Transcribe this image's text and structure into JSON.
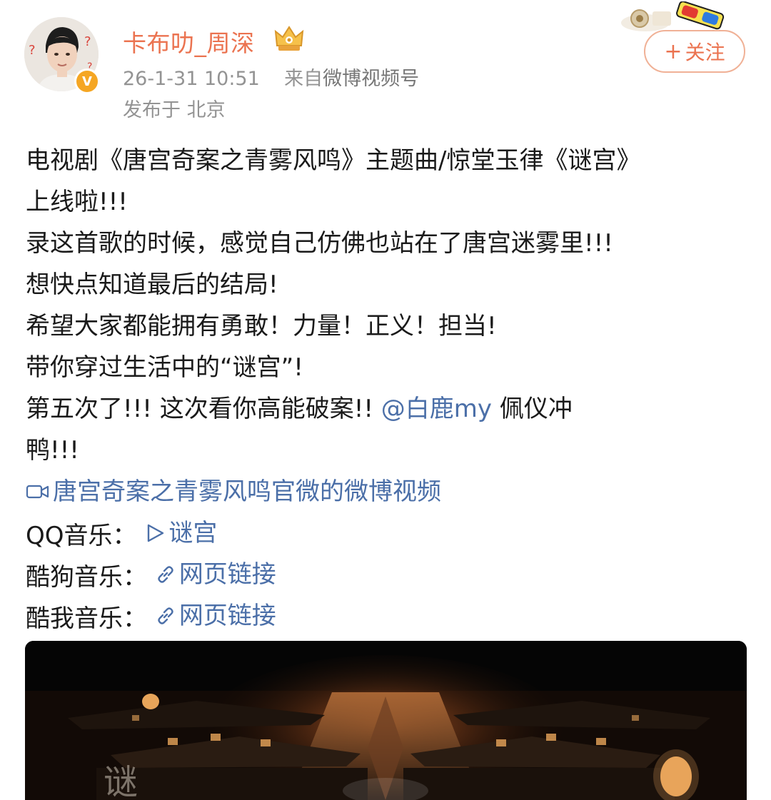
{
  "header": {
    "username": "卡布叻_周深",
    "timestamp": "26-1-31 10:51",
    "source_prefix": "来自",
    "source_name": "微博视频号",
    "location": "发布于 北京",
    "follow_label": "关注",
    "verified_glyph": "V",
    "icons": [
      "avatar",
      "verified-badge-icon",
      "crown-member-icon",
      "fan-badge-icon",
      "plus-icon"
    ]
  },
  "post": {
    "lines": [
      "电视剧《唐宫奇案之青雾风鸣》主题曲/惊堂玉律《谜宫》",
      "上线啦!!!",
      "录这首歌的时候，感觉自己仿佛也站在了唐宫迷雾里!!!",
      "想快点知道最后的结局!",
      "希望大家都能拥有勇敢！力量！正义！担当!",
      "带你穿过生活中的“谜宫”!"
    ],
    "line7_text": "第五次了!!! 这次看你高能破案!! ",
    "mention": "@白鹿my",
    "line7_tail": " 佩仪冲",
    "line8": "鸭!!!",
    "video_link": "唐宫奇案之青雾风鸣官微的微博视频",
    "music": [
      {
        "label": "QQ音乐：",
        "link": "谜宫",
        "icon": "play-icon"
      },
      {
        "label": "酷狗音乐：",
        "link": "网页链接",
        "icon": "link-icon"
      },
      {
        "label": "酷我音乐：",
        "link": "网页链接",
        "icon": "link-icon"
      }
    ]
  },
  "video": {
    "thumbnail_watermark": "谜",
    "colors": {
      "background": "#050505",
      "lantern": "#e8a55a",
      "glow": "#c9642a"
    }
  },
  "colors": {
    "username": "#eb7350",
    "link": "#4b6fa8",
    "meta": "#939393",
    "follow_border": "#f0b196"
  }
}
